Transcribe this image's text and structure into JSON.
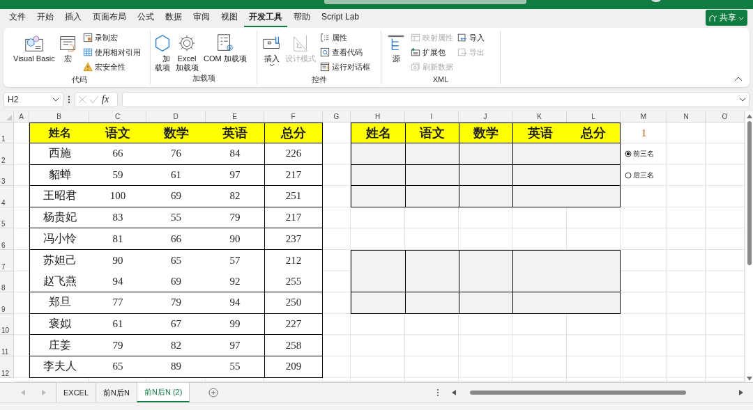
{
  "menu_tabs": [
    {
      "label": "文件",
      "selected": false
    },
    {
      "label": "开始",
      "selected": false
    },
    {
      "label": "插入",
      "selected": false
    },
    {
      "label": "页面布局",
      "selected": false
    },
    {
      "label": "公式",
      "selected": false
    },
    {
      "label": "数据",
      "selected": false
    },
    {
      "label": "审阅",
      "selected": false
    },
    {
      "label": "视图",
      "selected": false
    },
    {
      "label": "开发工具",
      "selected": true
    },
    {
      "label": "帮助",
      "selected": false
    },
    {
      "label": "Script Lab",
      "selected": false
    }
  ],
  "share_button": {
    "label": "共享"
  },
  "ribbon_groups": [
    {
      "label": "代码",
      "large": [
        {
          "label": "Visual Basic",
          "disabled": false,
          "dropdown": false
        },
        {
          "label": "宏",
          "disabled": false,
          "dropdown": false
        }
      ],
      "small_columns": [
        [
          {
            "label": "录制宏",
            "disabled": false
          },
          {
            "label": "使用相对引用",
            "disabled": false
          },
          {
            "label": "宏安全性",
            "disabled": false
          }
        ]
      ]
    },
    {
      "label": "加载项",
      "large": [
        {
          "label": "加载项",
          "disabled": false,
          "dropdown": false
        },
        {
          "label": "Excel 加载项",
          "disabled": false,
          "dropdown": false
        },
        {
          "label": "COM 加载项",
          "disabled": false,
          "dropdown": false
        }
      ]
    },
    {
      "label": "控件",
      "large": [
        {
          "label": "插入",
          "disabled": false,
          "dropdown": true
        },
        {
          "label": "设计模式",
          "disabled": true,
          "dropdown": false
        }
      ],
      "small_columns": [
        [
          {
            "label": "属性",
            "disabled": false
          },
          {
            "label": "查看代码",
            "disabled": false
          },
          {
            "label": "运行对话框",
            "disabled": false
          }
        ]
      ]
    },
    {
      "label": "XML",
      "large": [
        {
          "label": "源",
          "disabled": false,
          "dropdown": false
        }
      ],
      "small_columns": [
        [
          {
            "label": "映射属性",
            "disabled": true
          },
          {
            "label": "扩展包",
            "disabled": false
          },
          {
            "label": "刷新数据",
            "disabled": true
          }
        ],
        [
          {
            "label": "导入",
            "disabled": false
          },
          {
            "label": "导出",
            "disabled": true
          }
        ]
      ]
    }
  ],
  "formula_bar": {
    "name_box": "H2",
    "function_label": "fx"
  },
  "column_headers": [
    "A",
    "B",
    "C",
    "D",
    "E",
    "F",
    "G",
    "H",
    "I",
    "J",
    "K",
    "L",
    "M",
    "N",
    "O"
  ],
  "row_headers": [
    "1",
    "2",
    "3",
    "4",
    "5",
    "6",
    "7",
    "8",
    "9",
    "10",
    "11",
    "12"
  ],
  "score_table": {
    "columns": [
      "姓名",
      "语文",
      "数学",
      "英语",
      "总分"
    ],
    "blocks": [
      {
        "rows": [
          {
            "cells": [
              "西施",
              "66",
              "76",
              "84",
              "226"
            ]
          }
        ]
      },
      {
        "rows": [
          {
            "cells": [
              "貂蝉",
              "59",
              "61",
              "97",
              "217"
            ]
          }
        ]
      },
      {
        "rows": [
          {
            "cells": [
              "王昭君",
              "100",
              "69",
              "82",
              "251"
            ]
          }
        ]
      },
      {
        "rows": [
          {
            "cells": [
              "杨贵妃",
              "83",
              "55",
              "79",
              "217"
            ]
          }
        ]
      },
      {
        "rows": [
          {
            "cells": [
              "冯小怜",
              "81",
              "66",
              "90",
              "237"
            ]
          }
        ]
      },
      {
        "rows": [
          {
            "cells": [
              "苏妲己",
              "90",
              "65",
              "57",
              "212"
            ]
          },
          {
            "cells": [
              "赵飞燕",
              "94",
              "69",
              "92",
              "255"
            ]
          }
        ]
      },
      {
        "rows": [
          {
            "cells": [
              "郑旦",
              "77",
              "79",
              "94",
              "250"
            ]
          }
        ]
      },
      {
        "rows": [
          {
            "cells": [
              "褒姒",
              "61",
              "67",
              "99",
              "227"
            ]
          }
        ]
      },
      {
        "rows": [
          {
            "cells": [
              "庄姜",
              "79",
              "82",
              "97",
              "258"
            ]
          }
        ]
      },
      {
        "rows": [
          {
            "cells": [
              "李夫人",
              "65",
              "89",
              "55",
              "209"
            ]
          }
        ]
      }
    ]
  },
  "result_table": {
    "columns": [
      "姓名",
      "语文",
      "数学",
      "英语",
      "总分"
    ]
  },
  "counter": "1",
  "options": [
    {
      "label": "前三名",
      "selected": true
    },
    {
      "label": "后三名",
      "selected": false
    }
  ],
  "sheet_tabs": [
    {
      "label": "EXCEL",
      "selected": false
    },
    {
      "label": "前N后N",
      "selected": false
    },
    {
      "label": "前N后N (2)",
      "selected": true
    }
  ]
}
